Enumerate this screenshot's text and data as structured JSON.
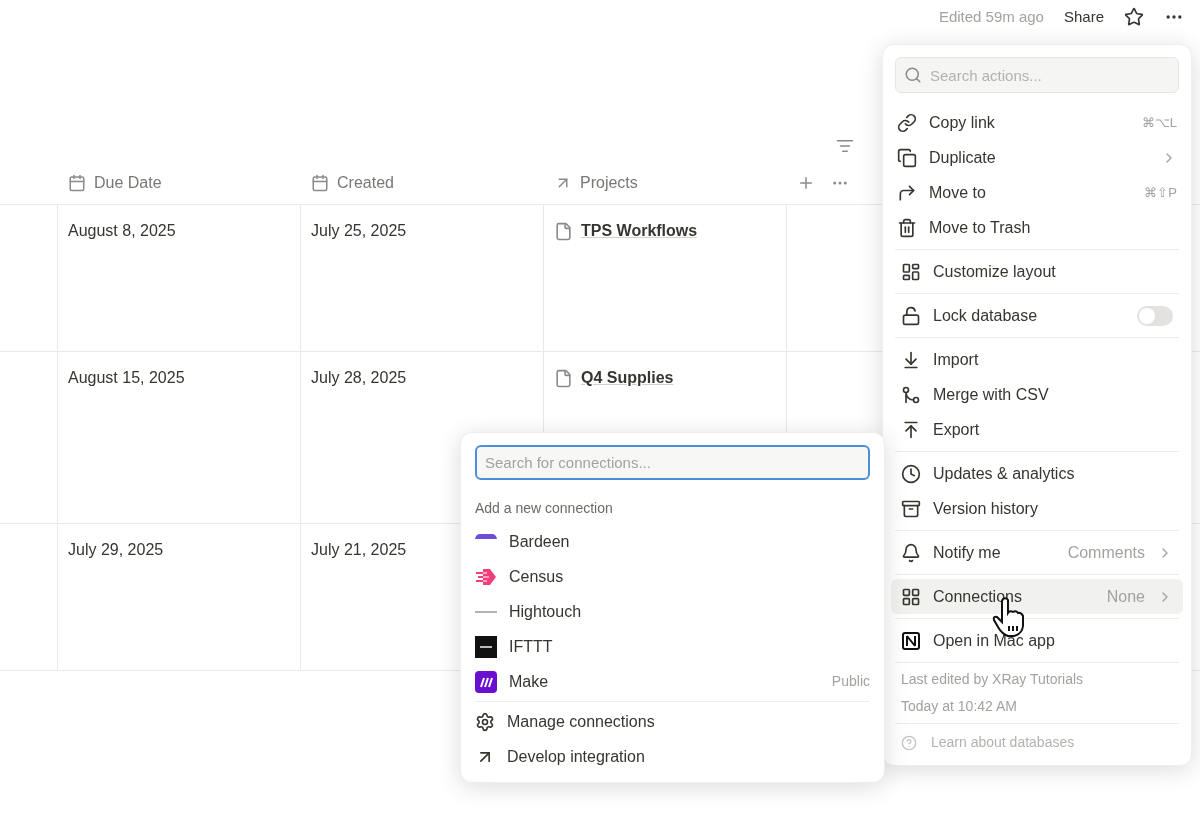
{
  "header": {
    "edited": "Edited 59m ago",
    "share": "Share"
  },
  "table": {
    "columns": [
      {
        "label": "Due Date",
        "kind": "date"
      },
      {
        "label": "Created",
        "kind": "date"
      },
      {
        "label": "Projects",
        "kind": "relation"
      }
    ],
    "rows": [
      {
        "due": "August 8, 2025",
        "created": "July 25, 2025",
        "project": "TPS Workflows"
      },
      {
        "due": "August 15, 2025",
        "created": "July 28, 2025",
        "project": "Q4 Supplies"
      },
      {
        "due": "July 29, 2025",
        "created": "July 21, 2025"
      }
    ]
  },
  "actions_menu": {
    "search": {
      "placeholder": "Search actions..."
    },
    "sections": [
      [
        {
          "label": "Copy link",
          "shortcut": "⌘⌥L"
        },
        {
          "label": "Duplicate",
          "submenu": true
        },
        {
          "label": "Move to",
          "shortcut": "⌘⇧P"
        },
        {
          "label": "Move to Trash"
        }
      ],
      [
        {
          "label": "Customize layout"
        }
      ],
      [
        {
          "label": "Lock database",
          "kind": "toggle",
          "on": false
        }
      ],
      [
        {
          "label": "Import"
        },
        {
          "label": "Merge with CSV"
        },
        {
          "label": "Export"
        }
      ],
      [
        {
          "label": "Updates & analytics"
        },
        {
          "label": "Version history"
        }
      ],
      [
        {
          "label": "Notify me",
          "value": "Comments",
          "submenu": true,
          "selected": false
        }
      ],
      [
        {
          "label": "Connections",
          "value": "None",
          "submenu": true,
          "selected": true
        }
      ],
      [
        {
          "label": "Open in Mac app"
        }
      ]
    ],
    "footer": {
      "edited_by": "Last edited by XRay Tutorials",
      "edited_at": "Today at 10:42 AM",
      "help": "Learn about databases"
    }
  },
  "connections_menu": {
    "search": {
      "placeholder": "Search for connections..."
    },
    "heading": "Add a new connection",
    "items": [
      {
        "name": "Bardeen"
      },
      {
        "name": "Census"
      },
      {
        "name": "Hightouch"
      },
      {
        "name": "IFTTT"
      },
      {
        "name": "Make",
        "tag": "Public"
      }
    ],
    "actions": [
      {
        "label": "Manage connections"
      },
      {
        "label": "Develop integration"
      }
    ]
  }
}
